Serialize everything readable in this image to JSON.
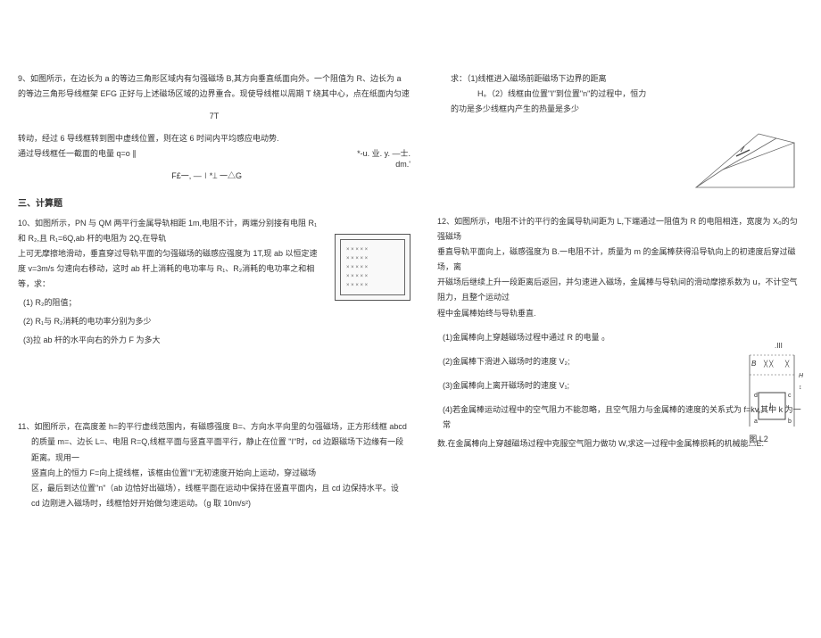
{
  "left": {
    "q9": {
      "l1": "9、如图所示，在边长为 a 的等边三角形区域内有匀强磁场 B,其方向垂直纸面向外。一个阻值为 R、边长为 a",
      "l2": "的等边三角形导线框架 EFG 正好与上述磁场区域的边界重合。现使导线框以周期 T 绕其中心，点在纸面内匀速",
      "l3sym": "7T",
      "l4": "转动，经过 6 导线框转到图中虚线位置，则在这 6 时间内平均感应电动势.",
      "l5": "通过导线框任一截面的电量 q=o ∥",
      "l5right": "*-u. 业. y. —士.",
      "formula": "F£一, —∣*⟘ 一△G",
      "formularight": "dm.'"
    },
    "section": "三、计算题",
    "q10": {
      "l1": "10、如图所示，PN 与 QM 两平行金属导轨相距 1m,电阻不计，两端分别接有电阻 R₁ 和 R₂,且 R₁=6Q,ab 杆的电阻为 2Q,在导轨",
      "l2": "上可无摩擦地滑动，垂直穿过导轨平面的匀强磁场的磁感应强度为 1T,现 ab 以恒定速",
      "l3": "度 v=3m/s 匀速向右移动，这时 ab 杆上消耗的电功率与 R₁、R₂消耗的电功率之和相等，求：",
      "sub1": "(1)   R₂的阻值；",
      "sub2": "(2)   R₁与 R₂消耗的电功率分别为多少",
      "sub3": "(3)拉 ab 杆的水平向右的外力         F 为多大"
    },
    "q11": {
      "l1": "11、如图所示，在高度差 h=的平行虚线范围内，有磁感强度 B=、方向水平向里的匀强磁场，正方形线框 abcd",
      "l2": "的质量 m=、边长 L=、电阻 R=Q,线框平面与竖直平面平行，静止在位置 \"I\"时，cd 边跟磁场下边缘有一段距离。现用一",
      "l3": "竖直向上的恒力 F=向上提线框，该框由位置\"I\"无初速度开始向上运动，穿过磁场",
      "l4": "区，最后到达位置\"n\"（ab 边恰好出磁场），线框平面在运动中保持在竖直平面内，且 cd 边保持水平。设",
      "l5": "cd 边刚进入磁场时，线框恰好开始做匀速运动。（g 取 10m/s²)"
    }
  },
  "right": {
    "q11b": {
      "l1": "求：（1)线框进入磁场前距磁场下边界的距离",
      "l1b": "H。（2）线框由位置\"I\"到位置\"n\"的过程中，恒力",
      "l2": "的功是多少线框内产生的热量是多少"
    },
    "q12": {
      "l1": "12、如图所示，电阻不计的平行的金属导轨间距为 L,下端通过一阻值为 R 的电阻相连，宽度为 X₀的匀强磁场",
      "l2": "垂直导轨平面向上，磁感强度为 B.一电阻不计，质量为 m 的金属棒获得沿导轨向上的初速度后穿过磁场，离",
      "l3": "开磁场后继续上升一段距离后返回，并匀速进入磁场，金属棒与导轨间的滑动摩擦系数为 u，不计空气阻力，且整个运动过",
      "l4": "程中金属棒始终与导轨垂直.",
      "sub1": "(1)金属棒向上穿越磁场过程中通过 R 的电量 ₀",
      "sub2": "(2)金属棒下滑进入磁场时的速度 V₂;",
      "sub3": "(3)金属棒向上离开磁场时的速度 V₁;",
      "sub4a": "(4)若金属棒运动过程中的空气阻力不能忽略，且空气阻力与金属棒的速度的关系式为 f=kv,其中 k 为一常",
      "sub4b": "数.在金属棒向上穿越磁场过程中克服空气阻力做功 W,求这一过程中金属棒损耗的机械能△E."
    },
    "figlabel": "图 L2",
    "figtext1": ".III",
    "figtext2": "B ╳ ╳|╳",
    "figtext3": "I"
  },
  "circuit_pattern": "× × × × ×\n× × × × ×\n× × × × ×\n× × × × ×\n× × × × ×"
}
